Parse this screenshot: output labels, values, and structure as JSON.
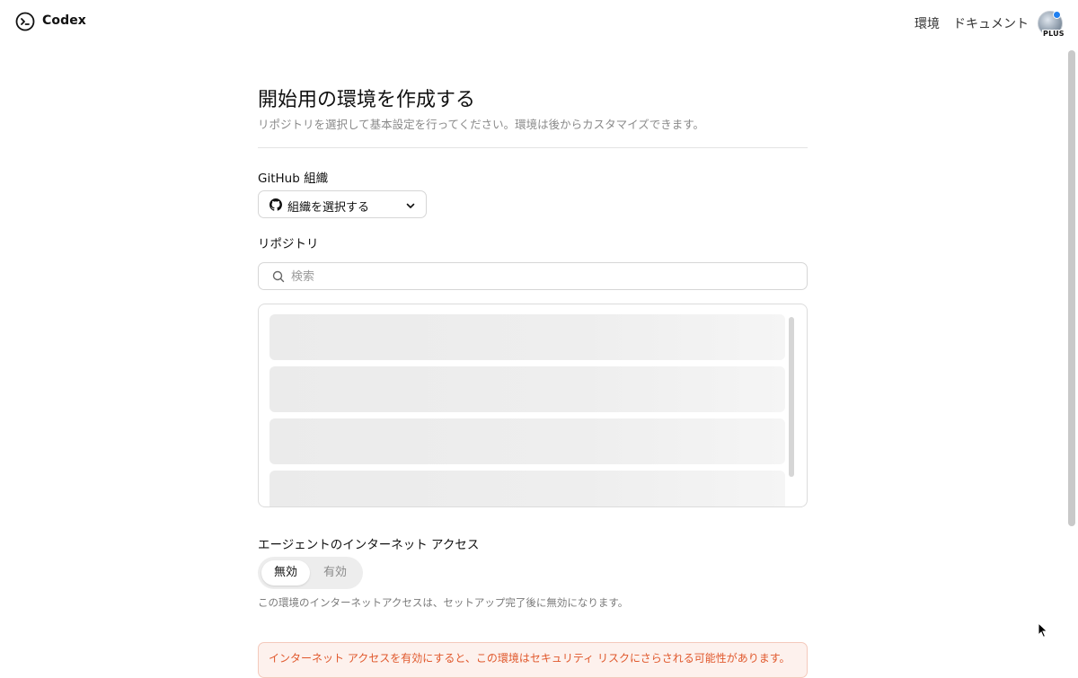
{
  "header": {
    "brand": "Codex",
    "nav": {
      "environments": "環境",
      "docs": "ドキュメント"
    },
    "plan_badge": "PLUS"
  },
  "page": {
    "title": "開始用の環境を作成する",
    "subtitle": "リポジトリを選択して基本設定を行ってください。環境は後からカスタマイズできます。"
  },
  "org": {
    "label": "GitHub 組織",
    "select_value": "組織を選択する"
  },
  "repo": {
    "label": "リポジトリ",
    "search_placeholder": "検索"
  },
  "internet_access": {
    "label": "エージェントのインターネット アクセス",
    "options": [
      "無効",
      "有効"
    ],
    "selected": "無効",
    "help": "この環境のインターネットアクセスは、セットアップ完了後に無効になります。",
    "warning": "インターネット アクセスを有効にすると、この環境はセキュリティ リスクにさらされる可能性があります。"
  },
  "colors": {
    "warning_text": "#e0582c",
    "warning_bg": "#fdf1ed",
    "notification_dot": "#1e7ff0"
  }
}
